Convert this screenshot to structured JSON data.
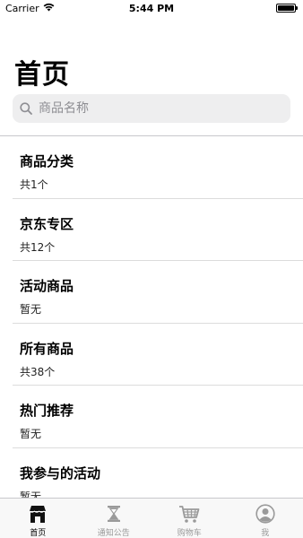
{
  "status_bar": {
    "carrier": "Carrier",
    "time": "5:44 PM"
  },
  "page_title": "首页",
  "search": {
    "placeholder": "商品名称"
  },
  "list": [
    {
      "title": "商品分类",
      "subtitle": "共1个"
    },
    {
      "title": "京东专区",
      "subtitle": "共12个"
    },
    {
      "title": "活动商品",
      "subtitle": "暂无"
    },
    {
      "title": "所有商品",
      "subtitle": "共38个"
    },
    {
      "title": "热门推荐",
      "subtitle": "暂无"
    },
    {
      "title": "我参与的活动",
      "subtitle": "暂无"
    }
  ],
  "tabs": [
    {
      "label": "首页",
      "icon": "store-icon",
      "active": true
    },
    {
      "label": "通知公告",
      "icon": "hourglass-icon",
      "active": false
    },
    {
      "label": "购物车",
      "icon": "cart-icon",
      "active": false
    },
    {
      "label": "我",
      "icon": "user-icon",
      "active": false
    }
  ],
  "colors": {
    "active_tab": "#000000",
    "inactive_tab": "#999999",
    "search_bg": "#eeeeef"
  }
}
